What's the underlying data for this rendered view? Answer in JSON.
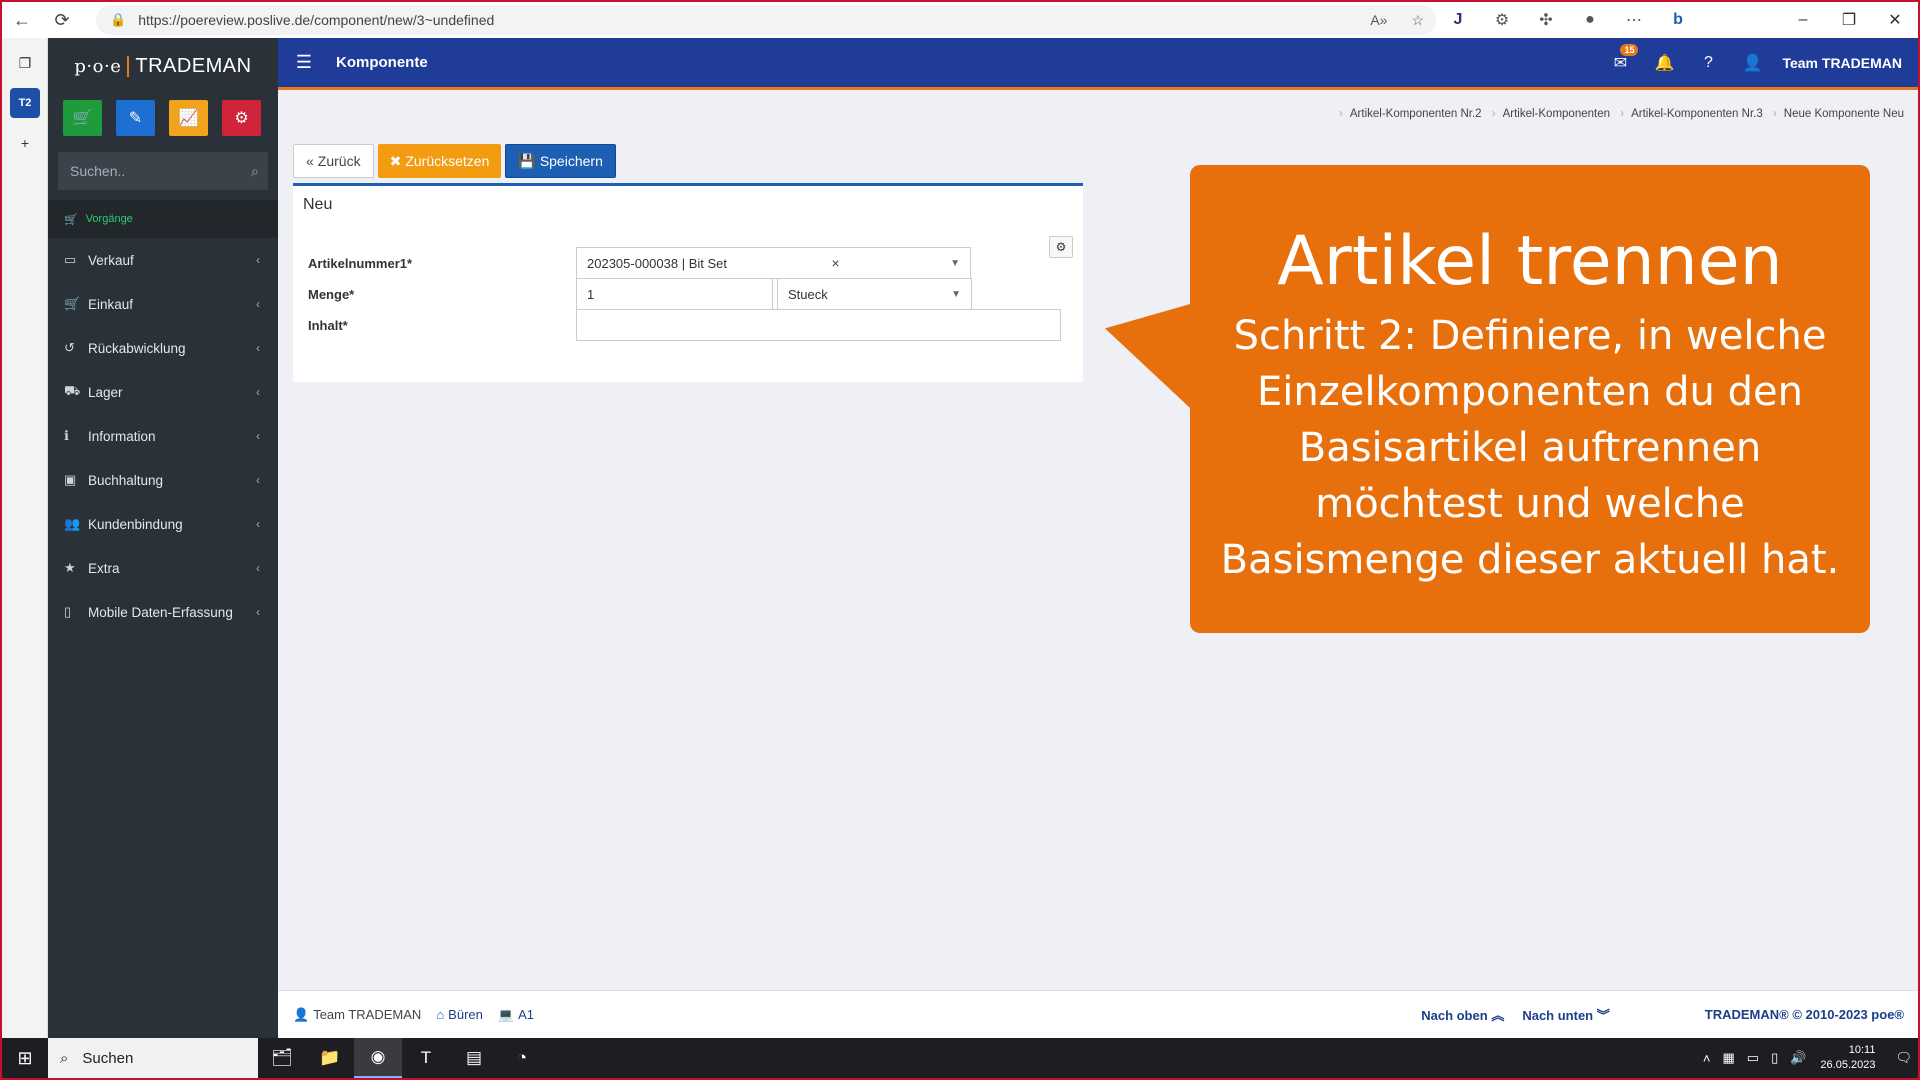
{
  "browser": {
    "url": "https://poereview.poslive.de/component/new/3~undefined"
  },
  "tabs": {
    "active_tab_label": "T2"
  },
  "sidebar": {
    "logo_prefix": "p·o·e",
    "logo_brand": "TRADEMAN",
    "quick_actions": [
      {
        "name": "cart",
        "color": "#1e9b3a"
      },
      {
        "name": "pencil",
        "color": "#1d6fd1"
      },
      {
        "name": "chart",
        "color": "#f0a31b"
      },
      {
        "name": "settings",
        "color": "#d0243a"
      }
    ],
    "search_placeholder": "Suchen..",
    "menu_header": "Vorgänge",
    "items": [
      {
        "label": "Verkauf",
        "icon": "monitor-icon"
      },
      {
        "label": "Einkauf",
        "icon": "cart-icon"
      },
      {
        "label": "Rückabwicklung",
        "icon": "undo-icon"
      },
      {
        "label": "Lager",
        "icon": "truck-icon"
      },
      {
        "label": "Information",
        "icon": "info-icon"
      },
      {
        "label": "Buchhaltung",
        "icon": "money-icon"
      },
      {
        "label": "Kundenbindung",
        "icon": "users-icon"
      },
      {
        "label": "Extra",
        "icon": "star-icon"
      },
      {
        "label": "Mobile Daten-Erfassung",
        "icon": "mobile-icon"
      }
    ]
  },
  "header": {
    "title": "Komponente",
    "mail_badge": "15",
    "user": "Team TRADEMAN"
  },
  "breadcrumb": [
    "Artikel-Komponenten Nr.2",
    "Artikel-Komponenten",
    "Artikel-Komponenten Nr.3",
    "Neue Komponente Neu"
  ],
  "toolbar": {
    "back_label": "Zurück",
    "reset_label": "Zurücksetzen",
    "save_label": "Speichern"
  },
  "form": {
    "title": "Neu",
    "article_label": "Artikelnummer1*",
    "article_value": "202305-000038 | Bit Set",
    "quantity_label": "Menge*",
    "quantity_value": "1",
    "unit_value": "Stueck",
    "content_label": "Inhalt*",
    "content_value": ""
  },
  "callout": {
    "title": "Artikel trennen",
    "text": "Schritt 2: Definiere, in welche Einzelkomponenten du den Basisartikel auftrennen möchtest und welche Basismenge dieser aktuell hat.",
    "color": "#e8700c"
  },
  "footer": {
    "user": "Team TRADEMAN",
    "location": "Büren",
    "device": "A1",
    "nav_up": "Nach oben",
    "nav_down": "Nach unten",
    "copyright": "TRADEMAN® © 2010-2023 poe®"
  },
  "taskbar": {
    "search_label": "Suchen",
    "time": "10:11",
    "date": "26.05.2023"
  },
  "colors": {
    "header_blue": "#1f3c99",
    "accent_orange": "#e9781a",
    "sidebar_dark": "#2b3138"
  }
}
